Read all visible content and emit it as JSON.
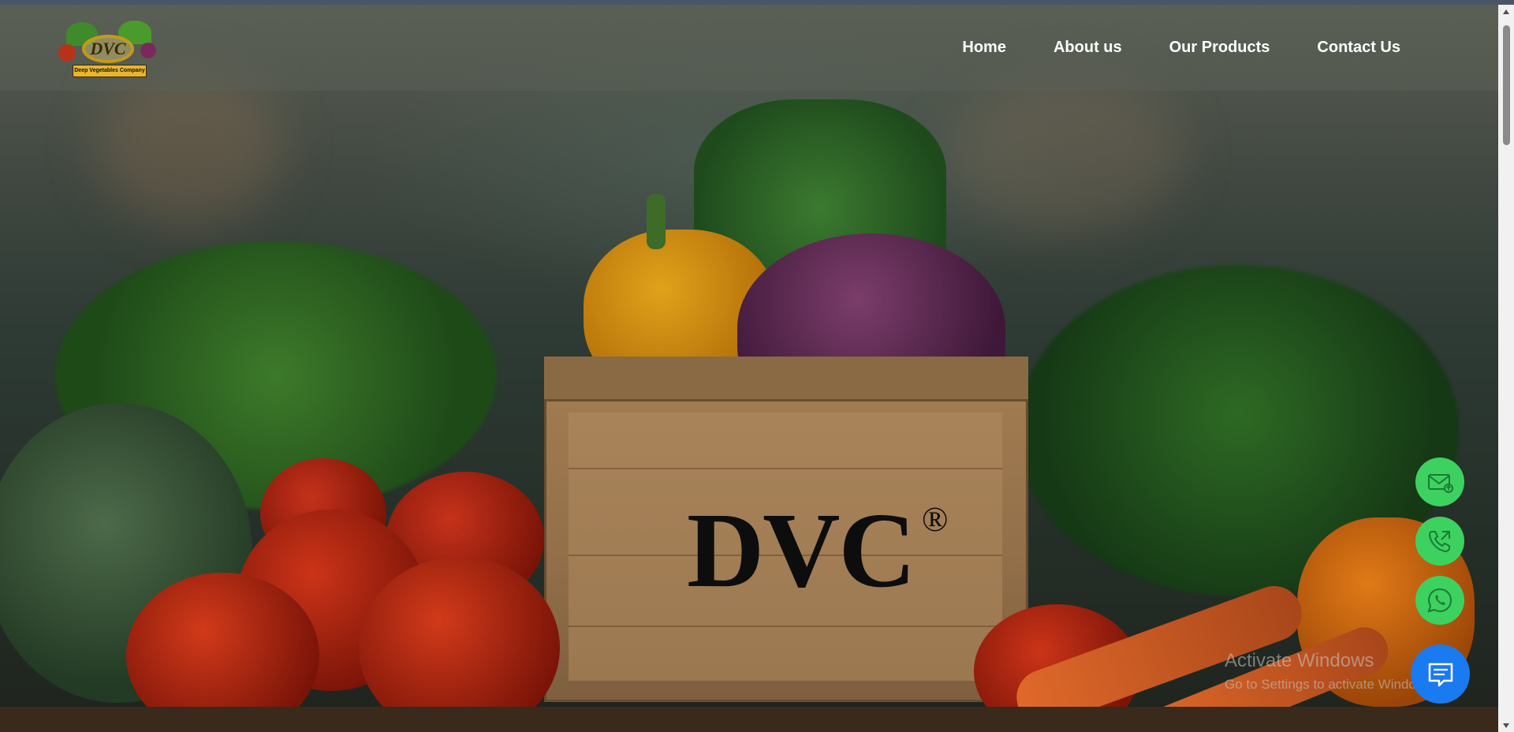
{
  "header": {
    "logo_brand": "DVC",
    "logo_company": "Deep Vegetables Company",
    "nav": [
      {
        "label": "Home"
      },
      {
        "label": "About us"
      },
      {
        "label": "Our Products"
      },
      {
        "label": "Contact Us"
      }
    ]
  },
  "hero": {
    "crate_brand": "DVC",
    "crate_registered": "®"
  },
  "floating_buttons": {
    "email_icon": "email-icon",
    "phone_icon": "phone-icon",
    "whatsapp_icon": "whatsapp-icon",
    "chat_icon": "chat-icon",
    "accent_green": "#3dd160",
    "accent_blue": "#1a7af0"
  },
  "os_watermark": {
    "title": "Activate Windows",
    "subtitle": "Go to Settings to activate Windows."
  }
}
